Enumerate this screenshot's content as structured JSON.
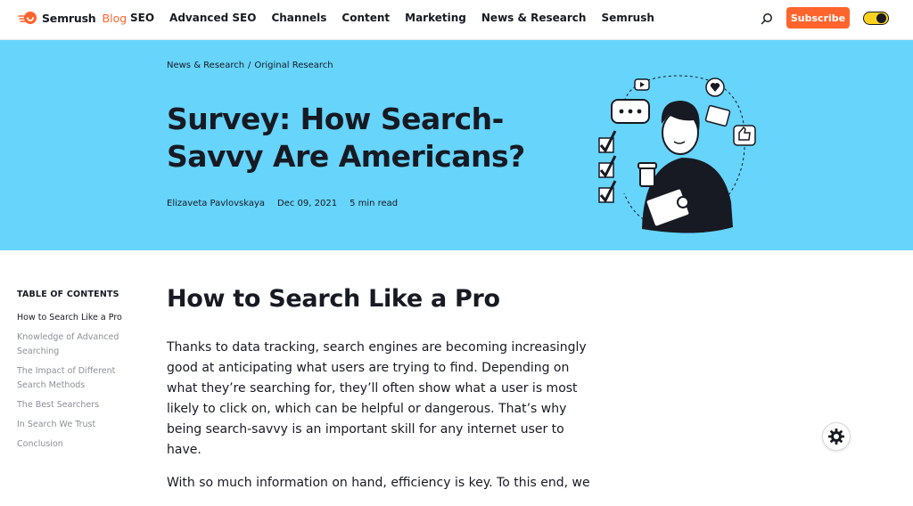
{
  "brand": {
    "name": "Semrush",
    "section": "Blog",
    "accent": "#ff642d"
  },
  "nav": [
    "SEO",
    "Advanced SEO",
    "Channels",
    "Content",
    "Marketing",
    "News & Research",
    "Semrush"
  ],
  "header": {
    "subscribe_label": "Subscribe",
    "search_icon": "search-icon",
    "theme_toggle": "toggle"
  },
  "hero": {
    "background": "#66d4fb",
    "breadcrumb": [
      "News & Research",
      "Original Research"
    ],
    "breadcrumb_separator": "/",
    "title": "Survey: How Search-Savvy Are Americans?",
    "author": "Elizaveta Pavlovskaya",
    "date": "Dec 09, 2021",
    "read_time": "5 min read"
  },
  "toc": {
    "heading": "TABLE OF CONTENTS",
    "items": [
      "How to Search Like a Pro",
      "Knowledge of Advanced Searching",
      "The Impact of Different Search Methods",
      "The Best Searchers",
      "In Search We Trust",
      "Conclusion"
    ],
    "active_index": 0
  },
  "article": {
    "heading": "How to Search Like a Pro",
    "paragraphs": [
      "Thanks to data tracking, search engines are becoming increasingly good at anticipating what users are trying to find. Depending on what they’re searching for, they’ll often show what a user is most likely to click on, which can be helpful or dangerous. That’s why being search-savvy is an important skill for any internet user to have.",
      "With so much information on hand, efficiency is key. To this end, we"
    ]
  },
  "floating": {
    "settings_icon": "gear-icon"
  }
}
